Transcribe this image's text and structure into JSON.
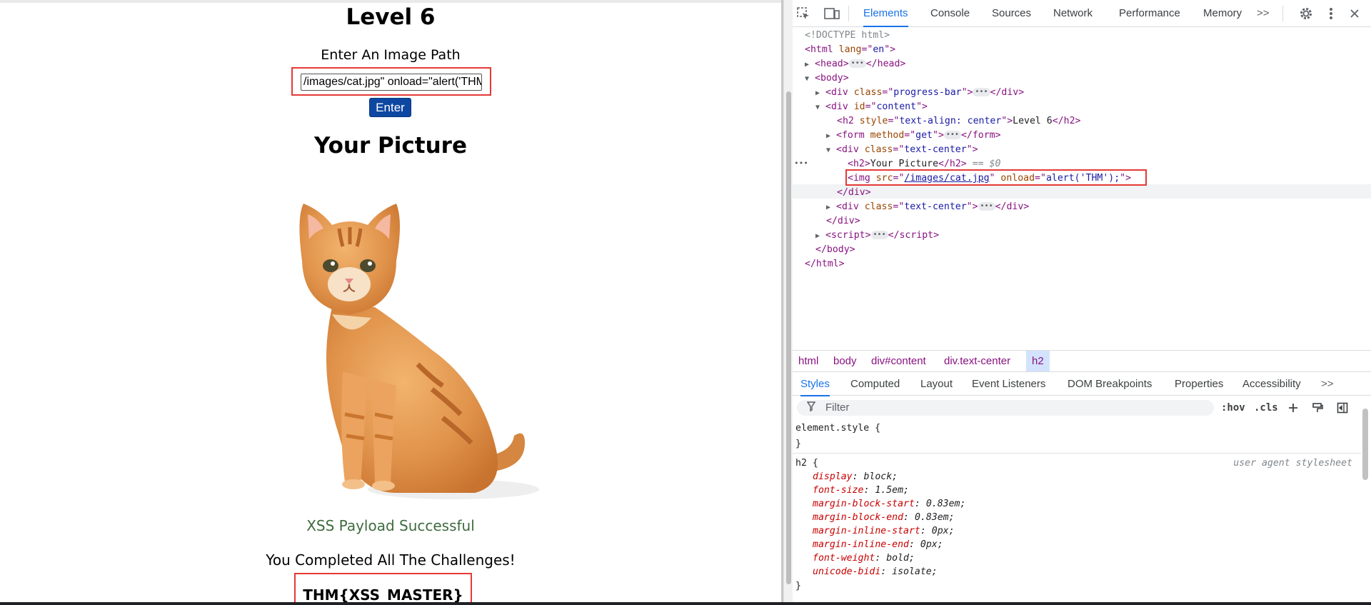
{
  "page": {
    "level_title": "Level 6",
    "prompt_label": "Enter An Image Path",
    "path_input_value": "/images/cat.jpg\" onload=\"alert('THM');",
    "enter_label": "Enter",
    "picture_title": "Your Picture",
    "success_text": "XSS Payload Successful",
    "completed_text": "You Completed All The Challenges!",
    "flag_text": "THM{XSS_MASTER}",
    "accent_colors": {
      "highlight": "#e53935",
      "button": "#0d47a1",
      "success": "#3e6b3e"
    }
  },
  "devtools": {
    "tabs": [
      "Elements",
      "Console",
      "Sources",
      "Network",
      "Performance",
      "Memory"
    ],
    "active_tab": "Elements",
    "overflow_icon": ">>",
    "dom": {
      "doctype": "<!DOCTYPE html>",
      "html_tag": "html",
      "lang_attr": "lang",
      "lang_val": "en",
      "head": "head",
      "body": "body",
      "progress_div_attr": "class",
      "progress_div_val": "progress-bar",
      "content_div_attr": "id",
      "content_div_val": "content",
      "h2_style_attr": "style",
      "h2_style_val": "text-align: center",
      "h2_text": "Level 6",
      "form_attr": "method",
      "form_val": "get",
      "tc_attr": "class",
      "tc_val": "text-center",
      "h2_pic_text": "Your Picture",
      "selected_marker": "== $0",
      "img_src_attr": "src",
      "img_src_val": "/images/cat.jpg",
      "img_onload_attr": "onload",
      "img_onload_val": "alert('THM');"
    },
    "breadcrumbs": [
      "html",
      "body",
      "div#content",
      "div.text-center",
      "h2"
    ],
    "style_tabs": [
      "Styles",
      "Computed",
      "Layout",
      "Event Listeners",
      "DOM Breakpoints",
      "Properties",
      "Accessibility"
    ],
    "filter_placeholder": "Filter",
    "hov_label": ":hov",
    "cls_label": ".cls",
    "element_style": "element.style {",
    "close_brace": "}",
    "h2_selector": "h2 {",
    "ua_label": "user agent stylesheet",
    "h2_props": [
      {
        "name": "display",
        "value": "block;"
      },
      {
        "name": "font-size",
        "value": "1.5em;"
      },
      {
        "name": "margin-block-start",
        "value": "0.83em;"
      },
      {
        "name": "margin-block-end",
        "value": "0.83em;"
      },
      {
        "name": "margin-inline-start",
        "value": "0px;"
      },
      {
        "name": "margin-inline-end",
        "value": "0px;"
      },
      {
        "name": "font-weight",
        "value": "bold;"
      },
      {
        "name": "unicode-bidi",
        "value": "isolate;"
      }
    ]
  }
}
